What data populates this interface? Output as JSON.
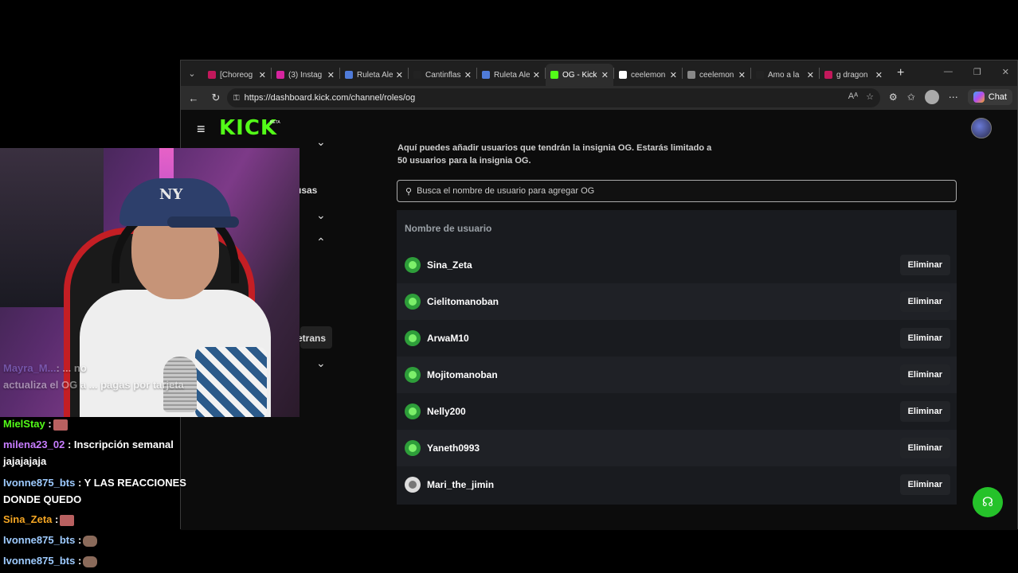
{
  "browser": {
    "tabs": [
      {
        "label": "[Choreog",
        "fav_color": "#c2185b"
      },
      {
        "label": "(3) Instag",
        "fav_color": "#d6249f"
      },
      {
        "label": "Ruleta Ale",
        "fav_color": "#4f7bd9"
      },
      {
        "label": "Cantinflas",
        "fav_color": "#222222"
      },
      {
        "label": "Ruleta Ale",
        "fav_color": "#4f7bd9"
      },
      {
        "label": "OG - Kick",
        "fav_color": "#53fc18"
      },
      {
        "label": "ceelemon",
        "fav_color": "#ffffff"
      },
      {
        "label": "ceelemon",
        "fav_color": "#888888"
      },
      {
        "label": "Amo a la",
        "fav_color": "#222222"
      },
      {
        "label": "g dragon",
        "fav_color": "#c2185b"
      }
    ],
    "active_tab_index": 5,
    "url": "https://dashboard.kick.com/channel/roles/og",
    "chat_label": "Chat"
  },
  "page": {
    "logo": "KICK",
    "logo_badge": "BETA",
    "description": "Aquí puedes añadir usuarios que tendrán la insignia OG. Estarás limitado a 50 usuarios para la insignia OG.",
    "sidebar_fragments": [
      "usas",
      "etrans"
    ],
    "search_placeholder": "Busca el nombre de usuario para agregar OG",
    "column_header": "Nombre de usuario",
    "delete_label": "Eliminar",
    "users": [
      {
        "name": "Sina_Zeta",
        "avatar": "kick-default"
      },
      {
        "name": "Cielitomanoban",
        "avatar": "kick-default"
      },
      {
        "name": "ArwaM10",
        "avatar": "kick-default"
      },
      {
        "name": "Mojitomanoban",
        "avatar": "kick-default"
      },
      {
        "name": "Nelly200",
        "avatar": "kick-default"
      },
      {
        "name": "Yaneth0993",
        "avatar": "kick-default"
      },
      {
        "name": "Mari_the_jimin",
        "avatar": "photo"
      }
    ]
  },
  "chat": {
    "messages": [
      {
        "user": "Mayra_M...",
        "user_color": "#9b87f5",
        "text": ": ... no",
        "line2": "actualiza el OG a ... pagas por tarjeta",
        "faded": true
      },
      {
        "user": "MielStay",
        "user_color": "#53fc18",
        "text": " :"
      },
      {
        "user": "milena23_02",
        "user_color": "#c77dff",
        "text": " : Inscripción semanal",
        "line2": "jajajajaja"
      },
      {
        "user": "Ivonne875_bts",
        "user_color": "#9ecbff",
        "text": " : Y LAS REACCIONES",
        "line2": "DONDE QUEDO"
      },
      {
        "user": "Sina_Zeta",
        "user_color": "#f5a623",
        "text": " :"
      },
      {
        "user": "Ivonne875_bts",
        "user_color": "#9ecbff",
        "text": " :"
      },
      {
        "user": "Ivonne875_bts",
        "user_color": "#9ecbff",
        "text": " :"
      }
    ]
  }
}
